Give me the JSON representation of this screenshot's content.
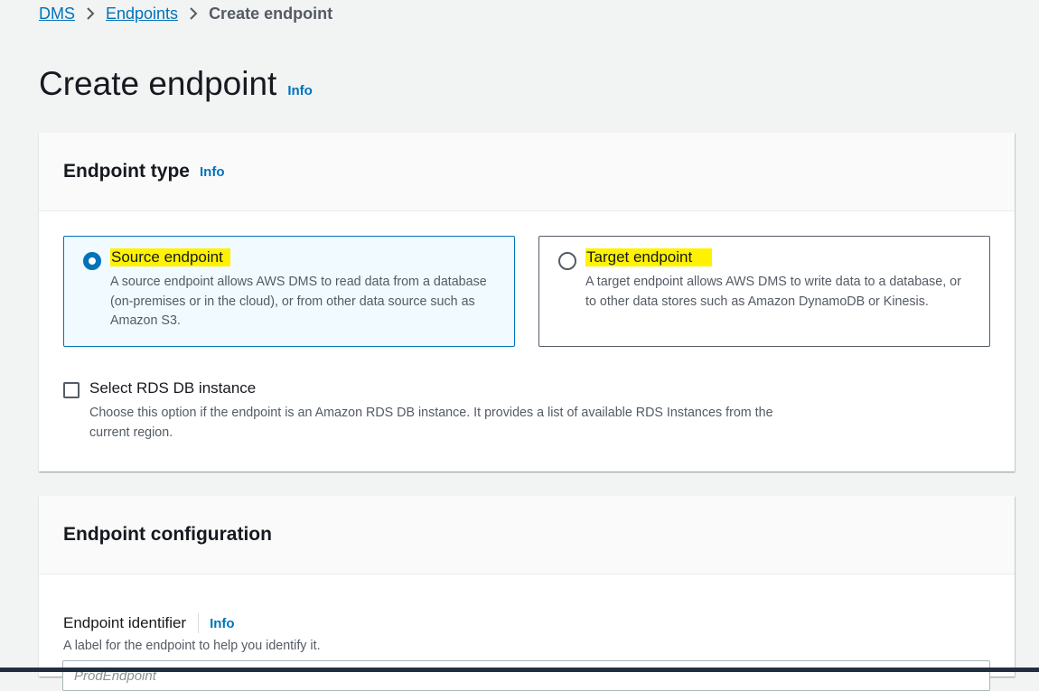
{
  "breadcrumb": {
    "items": [
      "DMS",
      "Endpoints"
    ],
    "current": "Create endpoint"
  },
  "page": {
    "title": "Create endpoint",
    "info_label": "Info"
  },
  "endpoint_type_panel": {
    "title": "Endpoint type",
    "info_label": "Info",
    "options": [
      {
        "label": "Source endpoint",
        "description": "A source endpoint allows AWS DMS to read data from a database (on-premises or in the cloud), or from other data source such as Amazon S3.",
        "selected": true
      },
      {
        "label": "Target endpoint",
        "description": "A target endpoint allows AWS DMS to write data to a database, or to other data stores such as Amazon DynamoDB or Kinesis.",
        "selected": false
      }
    ],
    "rds_checkbox": {
      "label": "Select RDS DB instance",
      "description": "Choose this option if the endpoint is an Amazon RDS DB instance. It provides a list of available RDS Instances from the current region.",
      "checked": false
    }
  },
  "endpoint_config_panel": {
    "title": "Endpoint configuration",
    "identifier_field": {
      "label": "Endpoint identifier",
      "info_label": "Info",
      "description": "A label for the endpoint to help you identify it.",
      "value": "",
      "placeholder": "ProdEndpoint"
    }
  },
  "colors": {
    "accent": "#0073bb",
    "highlight": "#fff200",
    "selected_tile_bg": "#f1faff",
    "page_bg": "#f2f3f3"
  }
}
